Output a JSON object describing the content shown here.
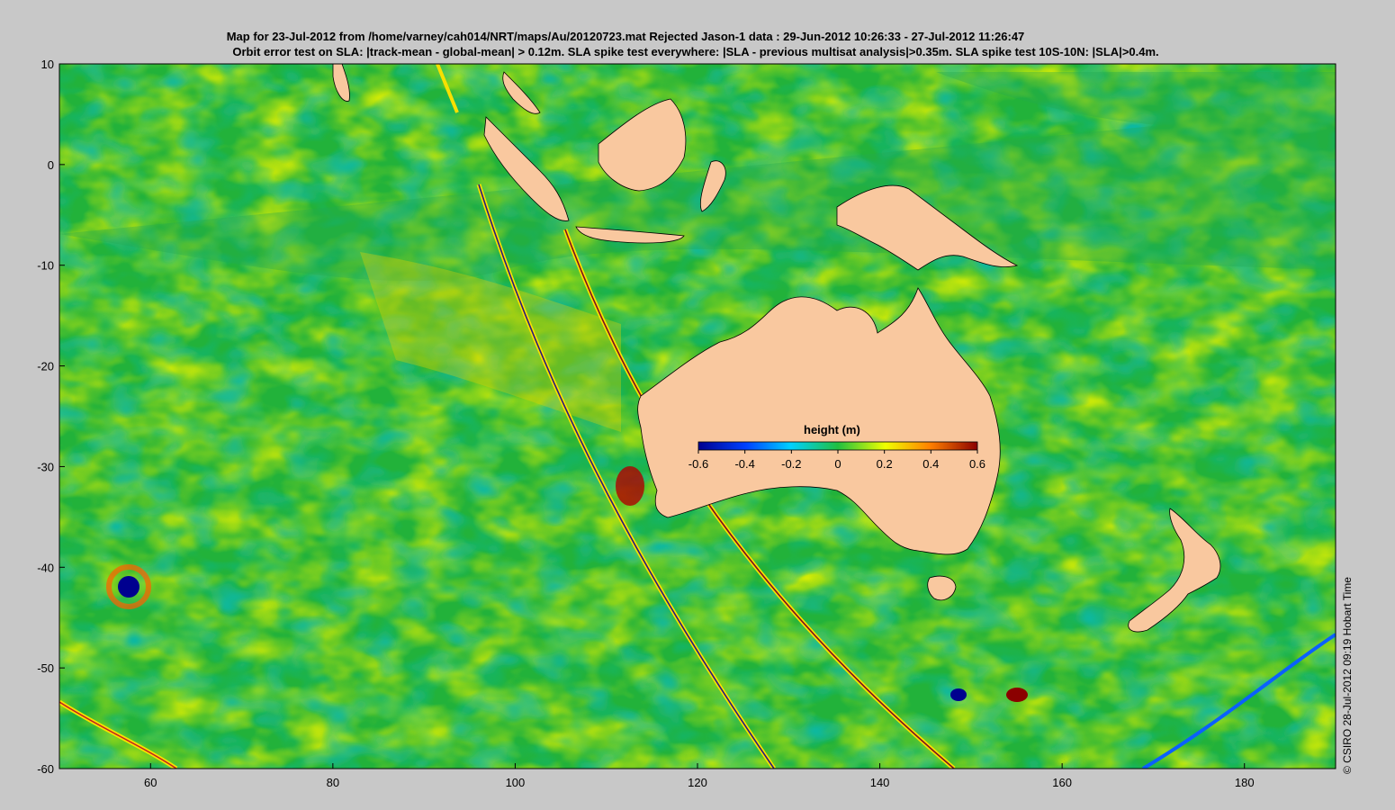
{
  "title_line1": "Map for 23-Jul-2012 from /home/varney/cah014/NRT/maps/Au/20120723.mat  Rejected Jason-1 data : 29-Jun-2012 10:26:33 - 27-Jul-2012 11:26:47",
  "title_line2": "Orbit error test on SLA: |track-mean  - global-mean| > 0.12m.  SLA spike test everywhere: |SLA - previous multisat analysis|>0.35m. SLA spike test 10S-10N: |SLA|>0.4m.",
  "credit": "© CSIRO 28-Jul-2012 09:19 Hobart Time",
  "map": {
    "lon_range": [
      50,
      190
    ],
    "lat_range": [
      -60,
      10
    ],
    "x_ticks": [
      "60",
      "80",
      "100",
      "120",
      "140",
      "160",
      "180"
    ],
    "y_ticks": [
      "10",
      "0",
      "-10",
      "-20",
      "-30",
      "-40",
      "-50",
      "-60"
    ],
    "land_color": "#f9c89f",
    "ocean_base_color": "#22b23a"
  },
  "colorbar": {
    "label": "height (m)",
    "ticks": [
      "-0.6",
      "-0.4",
      "-0.2",
      "0",
      "0.2",
      "0.4",
      "0.6"
    ],
    "colors": [
      "#00008f",
      "#0060ff",
      "#00e0ff",
      "#20c040",
      "#ffff00",
      "#ff8000",
      "#8b0000"
    ]
  }
}
